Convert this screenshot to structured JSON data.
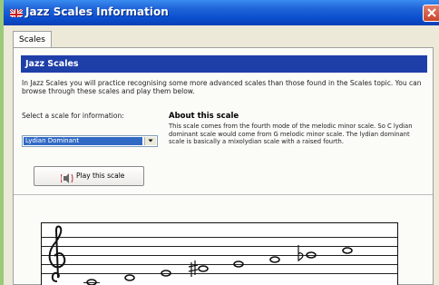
{
  "window": {
    "title": "Jazz Scales Information",
    "accent": "#0b4fcf",
    "close_icon": "close-icon"
  },
  "tabs": [
    {
      "label": "Scales",
      "selected": true
    }
  ],
  "panel": {
    "header": "Jazz Scales",
    "header_color": "#1f3fa8",
    "intro": "In Jazz Scales you will practice recognising some more advanced scales than those found in the Scales topic. You can browse through these scales and play them below.",
    "select_label": "Select a scale for information:",
    "selected_scale": "Lydian Dominant",
    "about_title": "About this scale",
    "about_text": "This scale comes from the fourth mode of the melodic minor scale.  So C lydian dominant scale would come from G melodic minor scale.  The lydian dominant scale is basically a mixolydian scale with a raised fourth.",
    "play_button": "Play this scale",
    "play_icon": "speaker-icon"
  }
}
